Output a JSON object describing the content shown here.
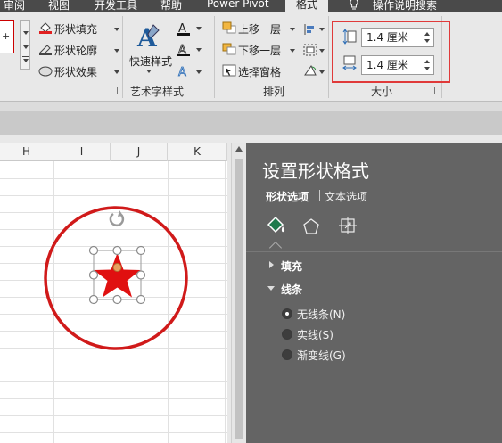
{
  "tabs": [
    {
      "label": "审阅",
      "active": false
    },
    {
      "label": "视图",
      "active": false
    },
    {
      "label": "开发工具",
      "active": false
    },
    {
      "label": "帮助",
      "active": false
    },
    {
      "label": "Power Pivot",
      "active": false
    },
    {
      "label": "格式",
      "active": true
    },
    {
      "label": "操作说明搜索",
      "active": false
    }
  ],
  "ribbon": {
    "shape_styles": {
      "fill": "形状填充",
      "outline": "形状轮廓",
      "effects": "形状效果"
    },
    "wordart": {
      "quick_styles": "快速样式",
      "group_label": "艺术字样式"
    },
    "arrange": {
      "bring_forward": "上移一层",
      "send_backward": "下移一层",
      "selection_pane": "选择窗格",
      "group_label": "排列"
    },
    "size": {
      "height": "1.4 厘米",
      "width": "1.4 厘米",
      "group_label": "大小"
    }
  },
  "sheet": {
    "columns": [
      "H",
      "I",
      "J",
      "K"
    ]
  },
  "pane": {
    "title": "设置形状格式",
    "tab_shape": "形状选项",
    "tab_text": "文本选项",
    "fill_section": "填充",
    "line_section": "线条",
    "line_options": [
      "无线条(N)",
      "实线(S)",
      "渐变线(G)"
    ]
  },
  "colors": {
    "highlight": "#e03a3a",
    "star": "#e01010",
    "circle": "#d01a1a",
    "pane_bg": "#646464",
    "accent_green": "#1f7a4d"
  }
}
